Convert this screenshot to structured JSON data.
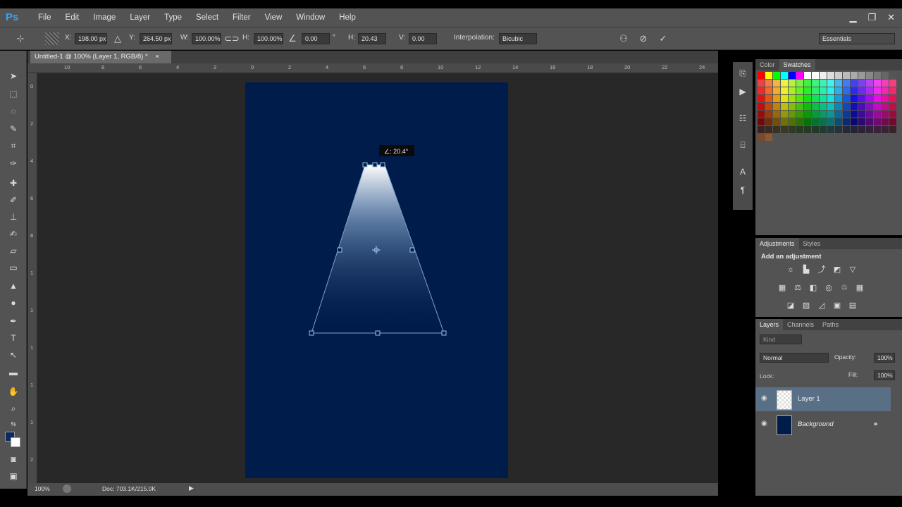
{
  "app": {
    "logo": "Ps"
  },
  "menu": {
    "items": [
      "File",
      "Edit",
      "Image",
      "Layer",
      "Type",
      "Select",
      "Filter",
      "View",
      "Window",
      "Help"
    ]
  },
  "window_controls": {
    "minimize": "▁",
    "restore": "❐",
    "close": "✕"
  },
  "options": {
    "x_label": "X:",
    "x_value": "198.00 px",
    "y_label": "Y:",
    "y_value": "264.50 px",
    "w_label": "W:",
    "w_value": "100.00%",
    "h_label": "H:",
    "h_value": "100.00%",
    "angle_value": "0.00",
    "angle_unit": "°",
    "hskew_label": "H:",
    "hskew_value": "20.43",
    "vskew_label": "V:",
    "vskew_value": "0.00",
    "interp_label": "Interpolation:",
    "interp_value": "Bicubic",
    "workspace": "Essentials"
  },
  "document": {
    "tab_title": "Untitled-1 @ 100% (Layer 1, RGB/8) *",
    "tab_close": "×",
    "ruler_top_labels": [
      "10",
      "8",
      "6",
      "4",
      "2",
      "0",
      "2",
      "4",
      "6",
      "8",
      "10",
      "12",
      "14",
      "16",
      "18",
      "20",
      "22",
      "24"
    ],
    "ruler_left_labels": [
      "0",
      "2",
      "4",
      "6",
      "8",
      "1",
      "1",
      "1",
      "1",
      "1",
      "2",
      "2"
    ],
    "skew_tooltip": "∠: 20.4°",
    "zoom": "100%",
    "doc_info": "Doc: 703.1K/215.0K"
  },
  "panels": {
    "swatch_tabs": [
      "Color",
      "Swatches"
    ],
    "adjustment_tabs": [
      "Adjustments",
      "Styles"
    ],
    "adjustment_title": "Add an adjustment",
    "layer_tabs": [
      "Layers",
      "Channels",
      "Paths"
    ],
    "filter_kind": "Kind",
    "blend_mode": "Normal",
    "opacity_label": "Opacity:",
    "opacity_value": "100%",
    "lock_label": "Lock:",
    "fill_label": "Fill:",
    "fill_value": "100%",
    "layers": [
      {
        "name": "Layer 1",
        "selected": true
      },
      {
        "name": "Background",
        "selected": false
      }
    ]
  },
  "colors": {
    "artboard": "#001c4b",
    "foreground": "#0c2a5e",
    "background_swatch": "#ffffff",
    "ps_blue": "#2fa6ff",
    "selected_layer": "#596f85"
  },
  "icons": {
    "tools": [
      "move-tool-icon",
      "marquee-tool-icon",
      "lasso-tool-icon",
      "quick-select-tool-icon",
      "crop-tool-icon",
      "eyedropper-tool-icon",
      "healing-brush-icon",
      "brush-tool-icon",
      "clone-stamp-icon",
      "history-brush-icon",
      "eraser-tool-icon",
      "gradient-tool-icon",
      "blur-tool-icon",
      "dodge-tool-icon",
      "pen-tool-icon",
      "type-tool-icon",
      "path-select-tool-icon",
      "shape-tool-icon",
      "hand-tool-icon",
      "zoom-tool-icon"
    ]
  }
}
